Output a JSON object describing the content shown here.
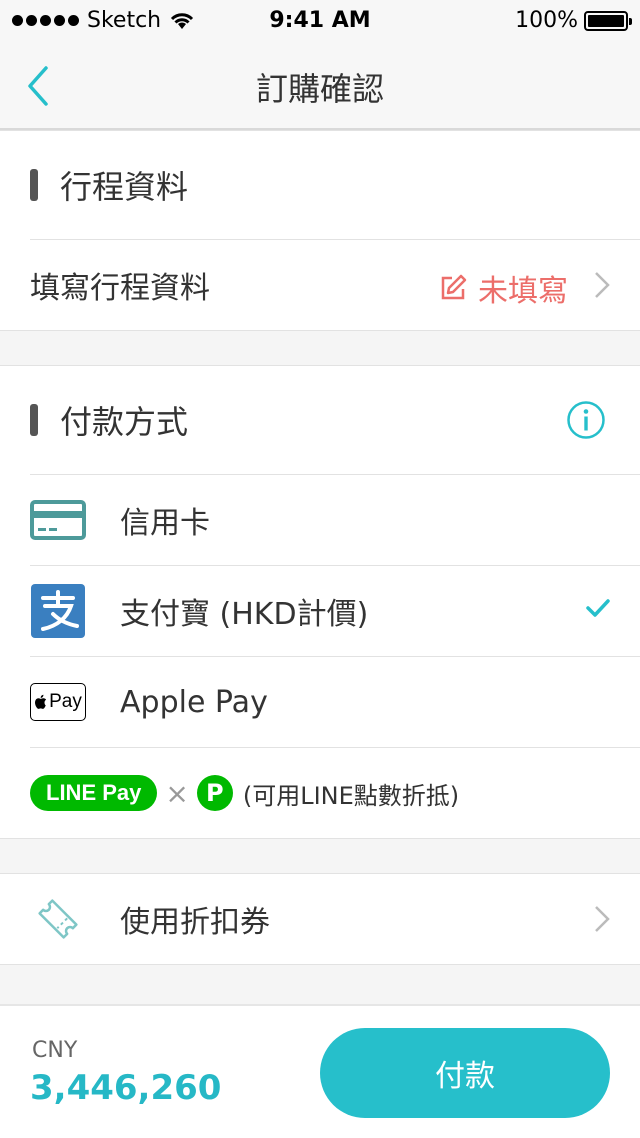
{
  "status_bar": {
    "carrier": "Sketch",
    "time": "9:41 AM",
    "battery": "100%"
  },
  "nav": {
    "title": "訂購確認"
  },
  "itinerary": {
    "heading": "行程資料",
    "row_label": "填寫行程資料",
    "row_status": "未填寫"
  },
  "payment": {
    "heading": "付款方式",
    "methods": [
      {
        "label": "信用卡"
      },
      {
        "label": "支付寶 (HKD計價)",
        "selected": true
      },
      {
        "label": "Apple Pay",
        "badge": "Pay"
      }
    ],
    "line": {
      "linepay_label": "LINE Pay",
      "times": "×",
      "points_label": "P",
      "note": "(可用LINE點數折抵)"
    }
  },
  "coupon": {
    "label": "使用折扣券"
  },
  "footer": {
    "currency": "CNY",
    "amount": "3,446,260",
    "pay_button": "付款"
  },
  "colors": {
    "accent": "#26bfcb",
    "warning": "#ec6e6a",
    "line_green": "#00b900",
    "alipay_blue": "#3a7fc0"
  }
}
